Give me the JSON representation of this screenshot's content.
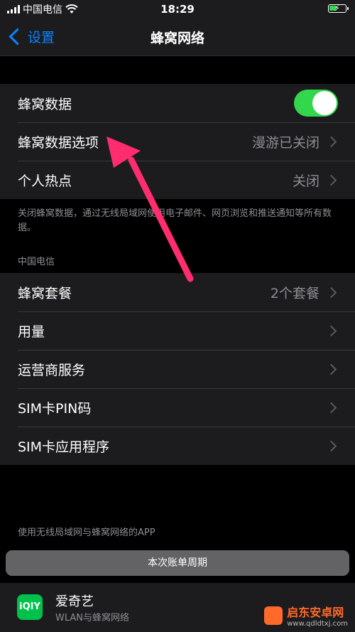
{
  "status": {
    "carrier": "中国电信",
    "time": "18:29"
  },
  "nav": {
    "back_label": "设置",
    "title": "蜂窝网络"
  },
  "group1": {
    "rows": [
      {
        "label": "蜂窝数据",
        "value": "",
        "toggle_on": true
      },
      {
        "label": "蜂窝数据选项",
        "value": "漫游已关闭"
      },
      {
        "label": "个人热点",
        "value": "关闭"
      }
    ]
  },
  "footnote": "关闭蜂窝数据，通过无线局域网使用电子邮件、网页浏览和推送通知等所有数据。",
  "section_carrier": "中国电信",
  "group2": {
    "rows": [
      {
        "label": "蜂窝套餐",
        "value": "2个套餐"
      },
      {
        "label": "用量",
        "value": ""
      },
      {
        "label": "运营商服务",
        "value": ""
      },
      {
        "label": "SIM卡PIN码",
        "value": ""
      },
      {
        "label": "SIM卡应用程序",
        "value": ""
      }
    ]
  },
  "section_apps": "使用无线局域网与蜂窝网络的APP",
  "billing_period": "本次账单周期",
  "app": {
    "icon_text": "iQIY",
    "name": "爱奇艺",
    "sub": "WLAN与蜂窝网络"
  },
  "watermark": {
    "text": "启东安卓网",
    "sub": "www.qdldtxj.com"
  },
  "colors": {
    "accent": "#0a84ff",
    "toggle_on": "#32d74b",
    "annotation": "#ff2d6f"
  }
}
